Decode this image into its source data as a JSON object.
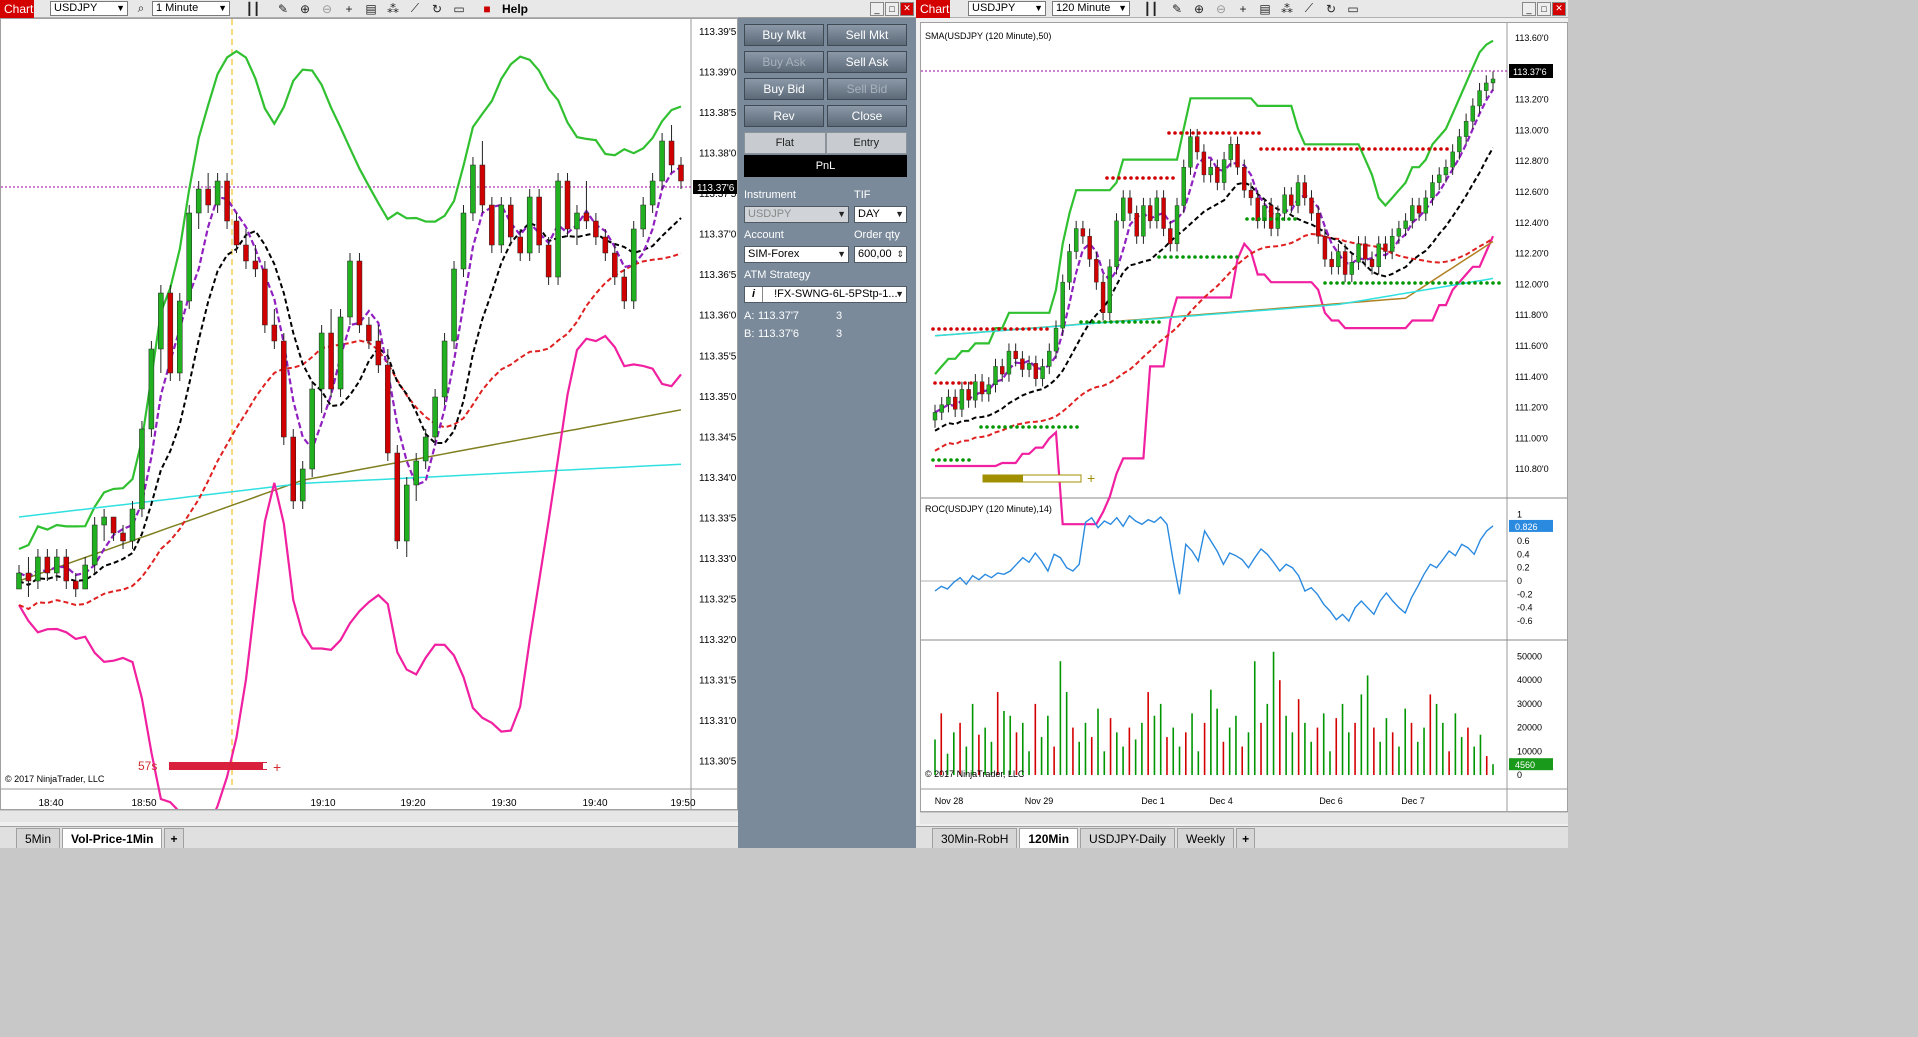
{
  "left": {
    "chart_tag": "Chart",
    "instrument": "USDJPY",
    "interval": "1 Minute",
    "help": "Help",
    "tabs": [
      "5Min",
      "Vol-Price-1Min"
    ],
    "active_tab": 1,
    "copyright": "© 2017 NinjaTrader, LLC",
    "timer": "57s",
    "last_price": "113.37'6"
  },
  "right": {
    "chart_tag": "Chart",
    "instrument": "USDJPY",
    "interval": "120 Minute",
    "tabs": [
      "30Min-RobH",
      "120Min",
      "USDJPY-Daily",
      "Weekly"
    ],
    "active_tab": 1,
    "price_panel_label": "SMA(USDJPY (120 Minute),50)",
    "roc_panel_label": "ROC(USDJPY (120 Minute),14)",
    "copyright": "© 2017 NinjaTrader, LLC",
    "last_price": "113.37'6",
    "roc_value": "0.826",
    "volume_value": "4560"
  },
  "order_panel": {
    "buttons": [
      {
        "label": "Buy Mkt",
        "enabled": true
      },
      {
        "label": "Sell Mkt",
        "enabled": true
      },
      {
        "label": "Buy Ask",
        "enabled": false
      },
      {
        "label": "Sell Ask",
        "enabled": true
      },
      {
        "label": "Buy Bid",
        "enabled": true
      },
      {
        "label": "Sell Bid",
        "enabled": false
      },
      {
        "label": "Rev",
        "enabled": true
      },
      {
        "label": "Close",
        "enabled": true
      }
    ],
    "flat_label": "Flat",
    "entry_label": "Entry",
    "pnl_label": "PnL",
    "instrument_label": "Instrument",
    "instrument_value": "USDJPY",
    "tif_label": "TIF",
    "tif_value": "DAY",
    "account_label": "Account",
    "account_value": "SIM-Forex",
    "order_qty_label": "Order qty",
    "order_qty_value": "600,00",
    "atm_label": "ATM Strategy",
    "atm_info": "i",
    "atm_value": "!FX-SWNG-6L-5PStp-1...",
    "ask_label": "A:",
    "ask_price": "113.37'7",
    "ask_size": "3",
    "bid_label": "B:",
    "bid_price": "113.37'6",
    "bid_size": "3"
  },
  "chart_data": [
    {
      "type": "candlestick",
      "title": "",
      "y_axis_ticks": [
        "113.39'5",
        "113.39'0",
        "113.38'5",
        "113.38'0",
        "113.37'5",
        "113.37'0",
        "113.36'5",
        "113.36'0",
        "113.35'5",
        "113.35'0",
        "113.34'5",
        "113.34'0",
        "113.33'5",
        "113.33'0",
        "113.32'5",
        "113.32'0",
        "113.31'5",
        "113.31'0",
        "113.30'5"
      ],
      "ylim": [
        113.3,
        113.395
      ],
      "x_axis_ticks": [
        "18:40",
        "18:50",
        "19:10",
        "19:20",
        "19:30",
        "19:40",
        "19:50"
      ],
      "candles": [
        [
          113.325,
          113.328,
          113.325,
          113.327
        ],
        [
          113.327,
          113.329,
          113.324,
          113.326
        ],
        [
          113.326,
          113.33,
          113.325,
          113.329
        ],
        [
          113.329,
          113.33,
          113.326,
          113.327
        ],
        [
          113.327,
          113.33,
          113.326,
          113.329
        ],
        [
          113.329,
          113.33,
          113.325,
          113.326
        ],
        [
          113.326,
          113.327,
          113.324,
          113.325
        ],
        [
          113.325,
          113.329,
          113.325,
          113.328
        ],
        [
          113.328,
          113.334,
          113.327,
          113.333
        ],
        [
          113.333,
          113.335,
          113.331,
          113.334
        ],
        [
          113.334,
          113.334,
          113.331,
          113.332
        ],
        [
          113.332,
          113.333,
          113.33,
          113.331
        ],
        [
          113.331,
          113.336,
          113.33,
          113.335
        ],
        [
          113.335,
          113.346,
          113.334,
          113.345
        ],
        [
          113.345,
          113.356,
          113.344,
          113.355
        ],
        [
          113.355,
          113.363,
          113.352,
          113.362
        ],
        [
          113.362,
          113.363,
          113.351,
          113.352
        ],
        [
          113.352,
          113.362,
          113.351,
          113.361
        ],
        [
          113.361,
          113.373,
          113.36,
          113.372
        ],
        [
          113.372,
          113.376,
          113.37,
          113.375
        ],
        [
          113.375,
          113.377,
          113.372,
          113.373
        ],
        [
          113.373,
          113.377,
          113.372,
          113.376
        ],
        [
          113.376,
          113.377,
          113.37,
          113.371
        ],
        [
          113.371,
          113.372,
          113.367,
          113.368
        ],
        [
          113.368,
          113.37,
          113.365,
          113.366
        ],
        [
          113.366,
          113.368,
          113.364,
          113.365
        ],
        [
          113.365,
          113.366,
          113.357,
          113.358
        ],
        [
          113.358,
          113.36,
          113.355,
          113.356
        ],
        [
          113.356,
          113.357,
          113.343,
          113.344
        ],
        [
          113.344,
          113.345,
          113.335,
          113.336
        ],
        [
          113.336,
          113.341,
          113.335,
          113.34
        ],
        [
          113.34,
          113.351,
          113.339,
          113.35
        ],
        [
          113.35,
          113.358,
          113.347,
          113.357
        ],
        [
          113.357,
          113.36,
          113.349,
          113.35
        ],
        [
          113.35,
          113.36,
          113.349,
          113.359
        ],
        [
          113.359,
          113.367,
          113.358,
          113.366
        ],
        [
          113.366,
          113.367,
          113.357,
          113.358
        ],
        [
          113.358,
          113.359,
          113.355,
          113.356
        ],
        [
          113.356,
          113.358,
          113.352,
          113.353
        ],
        [
          113.353,
          113.355,
          113.341,
          113.342
        ],
        [
          113.342,
          113.343,
          113.33,
          113.331
        ],
        [
          113.331,
          113.339,
          113.329,
          113.338
        ],
        [
          113.338,
          113.342,
          113.336,
          113.341
        ],
        [
          113.341,
          113.345,
          113.34,
          113.344
        ],
        [
          113.344,
          113.35,
          113.343,
          113.349
        ],
        [
          113.349,
          113.357,
          113.348,
          113.356
        ],
        [
          113.356,
          113.366,
          113.355,
          113.365
        ],
        [
          113.365,
          113.373,
          113.364,
          113.372
        ],
        [
          113.372,
          113.379,
          113.371,
          113.378
        ],
        [
          113.378,
          113.381,
          113.372,
          113.373
        ],
        [
          113.373,
          113.374,
          113.367,
          113.368
        ],
        [
          113.368,
          113.374,
          113.367,
          113.373
        ],
        [
          113.373,
          113.374,
          113.368,
          113.369
        ],
        [
          113.369,
          113.37,
          113.366,
          113.367
        ],
        [
          113.367,
          113.375,
          113.366,
          113.374
        ],
        [
          113.374,
          113.375,
          113.367,
          113.368
        ],
        [
          113.368,
          113.369,
          113.363,
          113.364
        ],
        [
          113.364,
          113.377,
          113.363,
          113.376
        ],
        [
          113.376,
          113.377,
          113.369,
          113.37
        ],
        [
          113.37,
          113.373,
          113.368,
          113.372
        ],
        [
          113.372,
          113.376,
          113.37,
          113.371
        ],
        [
          113.371,
          113.372,
          113.368,
          113.369
        ],
        [
          113.369,
          113.37,
          113.366,
          113.367
        ],
        [
          113.367,
          113.368,
          113.363,
          113.364
        ],
        [
          113.364,
          113.365,
          113.36,
          113.361
        ],
        [
          113.361,
          113.371,
          113.36,
          113.37
        ],
        [
          113.37,
          113.374,
          113.369,
          113.373
        ],
        [
          113.373,
          113.377,
          113.372,
          113.376
        ],
        [
          113.376,
          113.382,
          113.375,
          113.381
        ],
        [
          113.381,
          113.383,
          113.377,
          113.378
        ],
        [
          113.378,
          113.379,
          113.375,
          113.376
        ]
      ]
    },
    {
      "type": "candlestick",
      "title": "SMA(USDJPY (120 Minute),50)",
      "y_axis_ticks": [
        "113.60'0",
        "113.40'0",
        "113.20'0",
        "113.00'0",
        "112.80'0",
        "112.60'0",
        "112.40'0",
        "112.20'0",
        "112.00'0",
        "111.80'0",
        "111.60'0",
        "111.40'0",
        "111.20'0",
        "111.00'0",
        "110.80'0"
      ],
      "ylim": [
        110.7,
        113.65
      ],
      "x_axis_ticks": [
        "Nov 28",
        "Nov 29",
        "Dec 1",
        "Dec 4",
        "Dec 6",
        "Dec 7"
      ],
      "closes": [
        111.2,
        111.25,
        111.3,
        111.22,
        111.35,
        111.28,
        111.4,
        111.32,
        111.38,
        111.5,
        111.45,
        111.6,
        111.55,
        111.48,
        111.52,
        111.42,
        111.5,
        111.6,
        111.75,
        112.05,
        112.25,
        112.4,
        112.35,
        112.2,
        112.05,
        111.85,
        112.15,
        112.45,
        112.6,
        112.5,
        112.35,
        112.55,
        112.45,
        112.6,
        112.4,
        112.3,
        112.55,
        112.8,
        113.0,
        112.9,
        112.75,
        112.8,
        112.7,
        112.85,
        112.95,
        112.8,
        112.65,
        112.6,
        112.45,
        112.55,
        112.4,
        112.5,
        112.62,
        112.55,
        112.7,
        112.6,
        112.5,
        112.35,
        112.2,
        112.15,
        112.25,
        112.1,
        112.18,
        112.3,
        112.2,
        112.15,
        112.3,
        112.25,
        112.35,
        112.4,
        112.45,
        112.55,
        112.5,
        112.6,
        112.7,
        112.75,
        112.8,
        112.9,
        113.0,
        113.1,
        113.2,
        113.3,
        113.35,
        113.376
      ]
    },
    {
      "type": "line",
      "title": "ROC(USDJPY (120 Minute),14)",
      "y_axis_ticks": [
        "1",
        "0.8",
        "0.6",
        "0.4",
        "0.2",
        "0",
        "-0.2",
        "-0.4",
        "-0.6"
      ],
      "ylim": [
        -0.72,
        1.02
      ],
      "values": [
        -0.15,
        -0.08,
        -0.12,
        -0.02,
        0.05,
        -0.05,
        0.08,
        0.02,
        0.1,
        0.05,
        0.12,
        0.1,
        0.15,
        0.25,
        0.35,
        0.28,
        0.42,
        0.3,
        0.15,
        0.4,
        0.35,
        0.2,
        0.15,
        0.25,
        0.88,
        0.95,
        0.8,
        0.9,
        0.85,
        0.95,
        0.82,
        0.98,
        0.9,
        0.85,
        0.92,
        0.88,
        0.96,
        0.85,
        0.3,
        -0.2,
        0.55,
        0.45,
        0.3,
        0.75,
        0.6,
        0.45,
        0.25,
        0.42,
        0.38,
        0.32,
        0.2,
        0.35,
        0.48,
        0.4,
        0.28,
        0.15,
        0.25,
        0.2,
        0.08,
        -0.15,
        -0.1,
        -0.2,
        -0.35,
        -0.45,
        -0.58,
        -0.5,
        -0.6,
        -0.4,
        -0.3,
        -0.4,
        -0.5,
        -0.3,
        -0.18,
        -0.3,
        -0.4,
        -0.48,
        -0.25,
        -0.08,
        0.1,
        0.25,
        0.2,
        0.32,
        0.45,
        0.38,
        0.55,
        0.5,
        0.4,
        0.62,
        0.75,
        0.826
      ]
    },
    {
      "type": "bar",
      "title": "",
      "y_axis_ticks": [
        "50000",
        "40000",
        "30000",
        "20000",
        "10000",
        "0"
      ],
      "ylim": [
        0,
        54000
      ],
      "values": [
        15000,
        26000,
        9000,
        18000,
        22000,
        12000,
        30000,
        17000,
        20000,
        14000,
        35000,
        27000,
        25000,
        18000,
        22000,
        10000,
        30000,
        16000,
        25000,
        12000,
        48000,
        35000,
        20000,
        14000,
        22000,
        16000,
        28000,
        10000,
        24000,
        18000,
        12000,
        20000,
        15000,
        22000,
        35000,
        25000,
        30000,
        16000,
        20000,
        12000,
        18000,
        26000,
        10000,
        22000,
        36000,
        28000,
        14000,
        20000,
        25000,
        12000,
        18000,
        48000,
        22000,
        30000,
        52000,
        40000,
        25000,
        18000,
        32000,
        22000,
        14000,
        20000,
        26000,
        10000,
        24000,
        30000,
        18000,
        22000,
        34000,
        42000,
        20000,
        14000,
        24000,
        18000,
        12000,
        28000,
        22000,
        14000,
        20000,
        34000,
        30000,
        22000,
        10000,
        26000,
        16000,
        20000,
        12000,
        17000,
        8000,
        4560
      ],
      "colors_up": "#009600",
      "colors_down": "#d40000"
    }
  ]
}
